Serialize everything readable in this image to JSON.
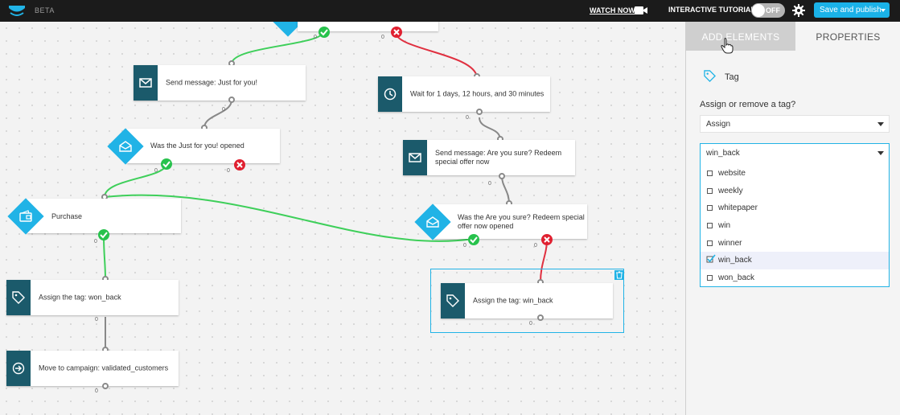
{
  "topbar": {
    "beta": "BETA",
    "watch_now": "WATCH NOW",
    "tutorial_label": "INTERACTIVE TUTORIAL",
    "toggle_state": "OFF",
    "publish": "Save and publish",
    "icons": [
      "logo-icon",
      "video-camera-icon",
      "gear-icon",
      "caret-down-icon"
    ]
  },
  "canvas": {
    "nodes": {
      "send_just_for_you": "Send message: Just for you!",
      "wait": "Wait for 1 days, 12 hours, and 30 minutes",
      "send_are_you_sure": "Send message: Are you sure? Redeem special offer now",
      "cond_opened": "Was the Just for you! opened",
      "purchase": "Purchase",
      "cond_are_you_sure": "Was the Are you sure? Redeem special offer now opened",
      "assign_won_back": "Assign the tag: won_back",
      "assign_win_back": "Assign the tag: win_back",
      "move_campaign": "Move to campaign: validated_customers"
    },
    "counter": "0",
    "colors": {
      "yes": "#27c24c",
      "no": "#e02030",
      "node_icon": "#1b5a6b",
      "accent": "#21b3e6"
    }
  },
  "panel": {
    "tabs": [
      "ADD ELEMENTS",
      "PROPERTIES"
    ],
    "element_name": "Tag",
    "question": "Assign or remove a tag?",
    "action_value": "Assign",
    "tag_value": "win_back",
    "options": [
      "website",
      "weekly",
      "whitepaper",
      "win",
      "winner",
      "win_back",
      "won_back"
    ],
    "selected_option": "win_back"
  }
}
